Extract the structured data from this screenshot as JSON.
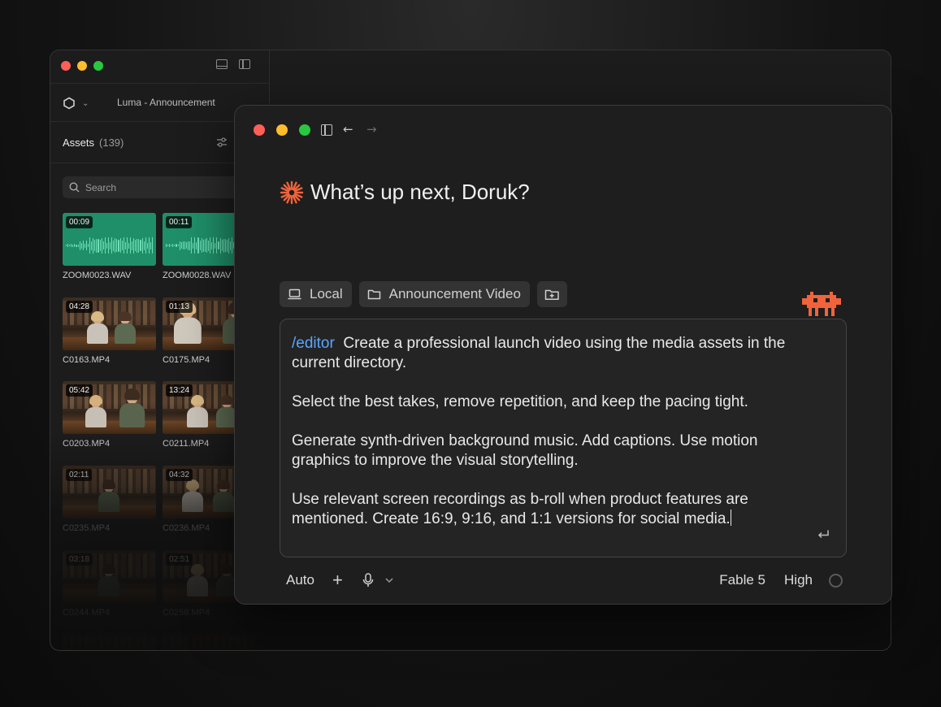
{
  "back_window": {
    "project_name": "Luma - Announcement",
    "assets_title": "Assets",
    "assets_count": "(139)",
    "search": {
      "placeholder": "Search",
      "value": ""
    },
    "assets": [
      {
        "name": "ZOOM0023.WAV",
        "duration": "00:09",
        "kind": "audio"
      },
      {
        "name": "ZOOM0028.WAV",
        "duration": "00:11",
        "kind": "audio"
      },
      {
        "name": "C0163.MP4",
        "duration": "04:28",
        "kind": "video"
      },
      {
        "name": "C0175.MP4",
        "duration": "01:13",
        "kind": "video"
      },
      {
        "name": "C0203.MP4",
        "duration": "05:42",
        "kind": "video"
      },
      {
        "name": "C0211.MP4",
        "duration": "13:24",
        "kind": "video"
      },
      {
        "name": "C0235.MP4",
        "duration": "02:11",
        "kind": "video"
      },
      {
        "name": "C0236.MP4",
        "duration": "04:32",
        "kind": "video"
      },
      {
        "name": "C0244.MP4",
        "duration": "03:18",
        "kind": "video"
      },
      {
        "name": "C0258.MP4",
        "duration": "02:51",
        "kind": "video"
      }
    ]
  },
  "front_window": {
    "greeting": "What’s up next, Doruk?",
    "context_chips": [
      {
        "label": "Local",
        "icon": "laptop-icon"
      },
      {
        "label": "Announcement Video",
        "icon": "folder-icon"
      },
      {
        "label": "",
        "icon": "folder-add-icon"
      }
    ],
    "prompt": {
      "command": "/editor",
      "text": "  Create a professional launch video using the media assets in the current directory.\n\nSelect the best takes, remove repetition, and keep the pacing tight.\n\nGenerate synth-driven background music. Add captions. Use motion graphics to improve the visual storytelling.\n\nUse relevant screen recordings as b-roll when product features are mentioned. Create 16:9, 9:16, and 1:1 versions for social media."
    },
    "bottom_bar": {
      "mode": "Auto",
      "model": "Fable 5",
      "effort": "High"
    }
  },
  "colors": {
    "accent_orange": "#f0633b",
    "slash_command_blue": "#5ba6ff",
    "audio_thumb_green": "#1f8f69"
  }
}
